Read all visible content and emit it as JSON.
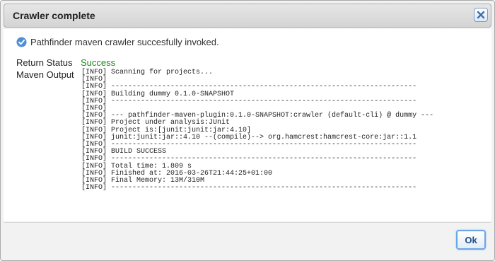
{
  "dialog": {
    "title": "Crawler complete",
    "close_icon": "close-icon",
    "message_icon": "check-circle-icon",
    "message": "Pathfinder maven crawler succesfully invoked.",
    "return_status_label": "Return Status",
    "return_status_value": "Success",
    "maven_output_label": "Maven Output",
    "maven_output_lines": [
      "[INFO] Scanning for projects...",
      "[INFO]",
      "[INFO] ------------------------------------------------------------------------",
      "[INFO] Building dummy 0.1.0-SNAPSHOT",
      "[INFO] ------------------------------------------------------------------------",
      "[INFO]",
      "[INFO] --- pathfinder-maven-plugin:0.1.0-SNAPSHOT:crawler (default-cli) @ dummy ---",
      "[INFO] Project under analysis:JUnit",
      "[INFO] Project is:[junit:junit:jar:4.10]",
      "[INFO] junit:junit:jar::4.10 --(compile)--> org.hamcrest:hamcrest-core:jar::1.1",
      "[INFO] ------------------------------------------------------------------------",
      "[INFO] BUILD SUCCESS",
      "[INFO] ------------------------------------------------------------------------",
      "[INFO] Total time: 1.809 s",
      "[INFO] Finished at: 2016-03-26T21:44:25+01:00",
      "[INFO] Final Memory: 13M/310M",
      "[INFO] ------------------------------------------------------------------------"
    ],
    "ok_label": "Ok"
  },
  "colors": {
    "success": "#1a8a1a",
    "accent": "#6aa6e6"
  }
}
